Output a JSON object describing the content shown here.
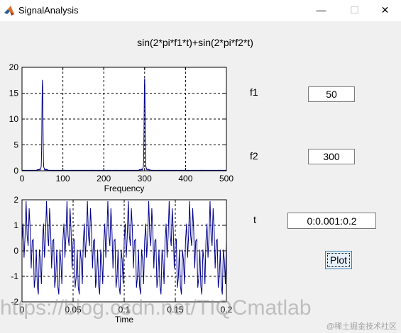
{
  "window": {
    "title": "SignalAnalysis",
    "minimize_glyph": "—",
    "maximize_glyph": "☐",
    "close_glyph": "✕",
    "icon": "matlab-icon"
  },
  "figure_title": "sin(2*pi*f1*t)+sin(2*pi*f2*t)",
  "controls": {
    "f1": {
      "label": "f1",
      "value": "50"
    },
    "f2": {
      "label": "f2",
      "value": "300"
    },
    "t": {
      "label": "t",
      "value": "0:0.001:0.2"
    },
    "plot_button": "Plot"
  },
  "chart_data": [
    {
      "type": "line",
      "xlabel": "Frequency",
      "ylabel": "",
      "xlim": [
        0,
        500
      ],
      "ylim": [
        0,
        20
      ],
      "xticks": [
        "0",
        "100",
        "200",
        "300",
        "400",
        "500"
      ],
      "yticks": [
        "0",
        "5",
        "10",
        "15",
        "20"
      ],
      "grid": true,
      "line_color": "#00008b",
      "peaks": [
        {
          "x": 50,
          "y": 17.5
        },
        {
          "x": 300,
          "y": 17.8
        }
      ]
    },
    {
      "type": "line",
      "xlabel": "Time",
      "ylabel": "",
      "xlim": [
        0,
        0.2
      ],
      "ylim": [
        -2,
        2
      ],
      "xticks": [
        "0",
        "0.05",
        "0.1",
        "0.15",
        "0.2"
      ],
      "yticks": [
        "-2",
        "-1",
        "0",
        "1",
        "2"
      ],
      "grid": true,
      "line_color": "#00008b",
      "f1": 50,
      "f2": 300,
      "t_step": 0.001
    }
  ],
  "watermark": {
    "main": "https://blog.csdn.net/TIQCmatlab",
    "corner": "@稀土掘金技术社区"
  }
}
